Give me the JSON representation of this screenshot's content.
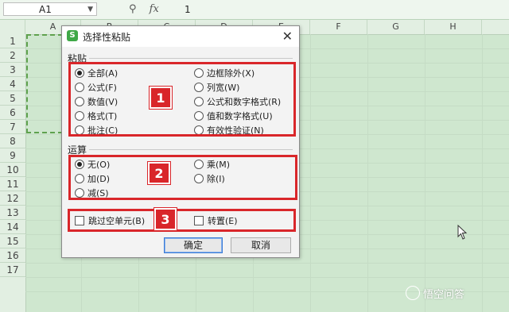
{
  "formula_bar": {
    "cell_ref": "A1",
    "fx_label": "fx",
    "value": "1"
  },
  "sheet": {
    "columns": [
      "A",
      "B",
      "C",
      "D",
      "E",
      "F",
      "G",
      "H"
    ],
    "rows": [
      "1",
      "2",
      "3",
      "4",
      "5",
      "6",
      "7",
      "8",
      "9",
      "10",
      "11",
      "12",
      "13",
      "14",
      "15",
      "16",
      "17"
    ]
  },
  "dialog": {
    "title": "选择性粘贴",
    "paste_section": "粘贴",
    "paste_left": [
      "全部(A)",
      "公式(F)",
      "数值(V)",
      "格式(T)",
      "批注(C)"
    ],
    "paste_right": [
      "边框除外(X)",
      "列宽(W)",
      "公式和数字格式(R)",
      "值和数字格式(U)",
      "有效性验证(N)"
    ],
    "operation_section": "运算",
    "op_left": [
      "无(O)",
      "加(D)",
      "减(S)"
    ],
    "op_right": [
      "乘(M)",
      "除(I)"
    ],
    "skip_blanks": "跳过空单元(B)",
    "transpose": "转置(E)",
    "ok": "确定",
    "cancel": "取消"
  },
  "badges": [
    "1",
    "2",
    "3"
  ],
  "watermark": "悟空问答",
  "colors": {
    "accent_red": "#d9262a",
    "sheet_bg": "#cfe7cf",
    "app_green": "#3fa847"
  }
}
